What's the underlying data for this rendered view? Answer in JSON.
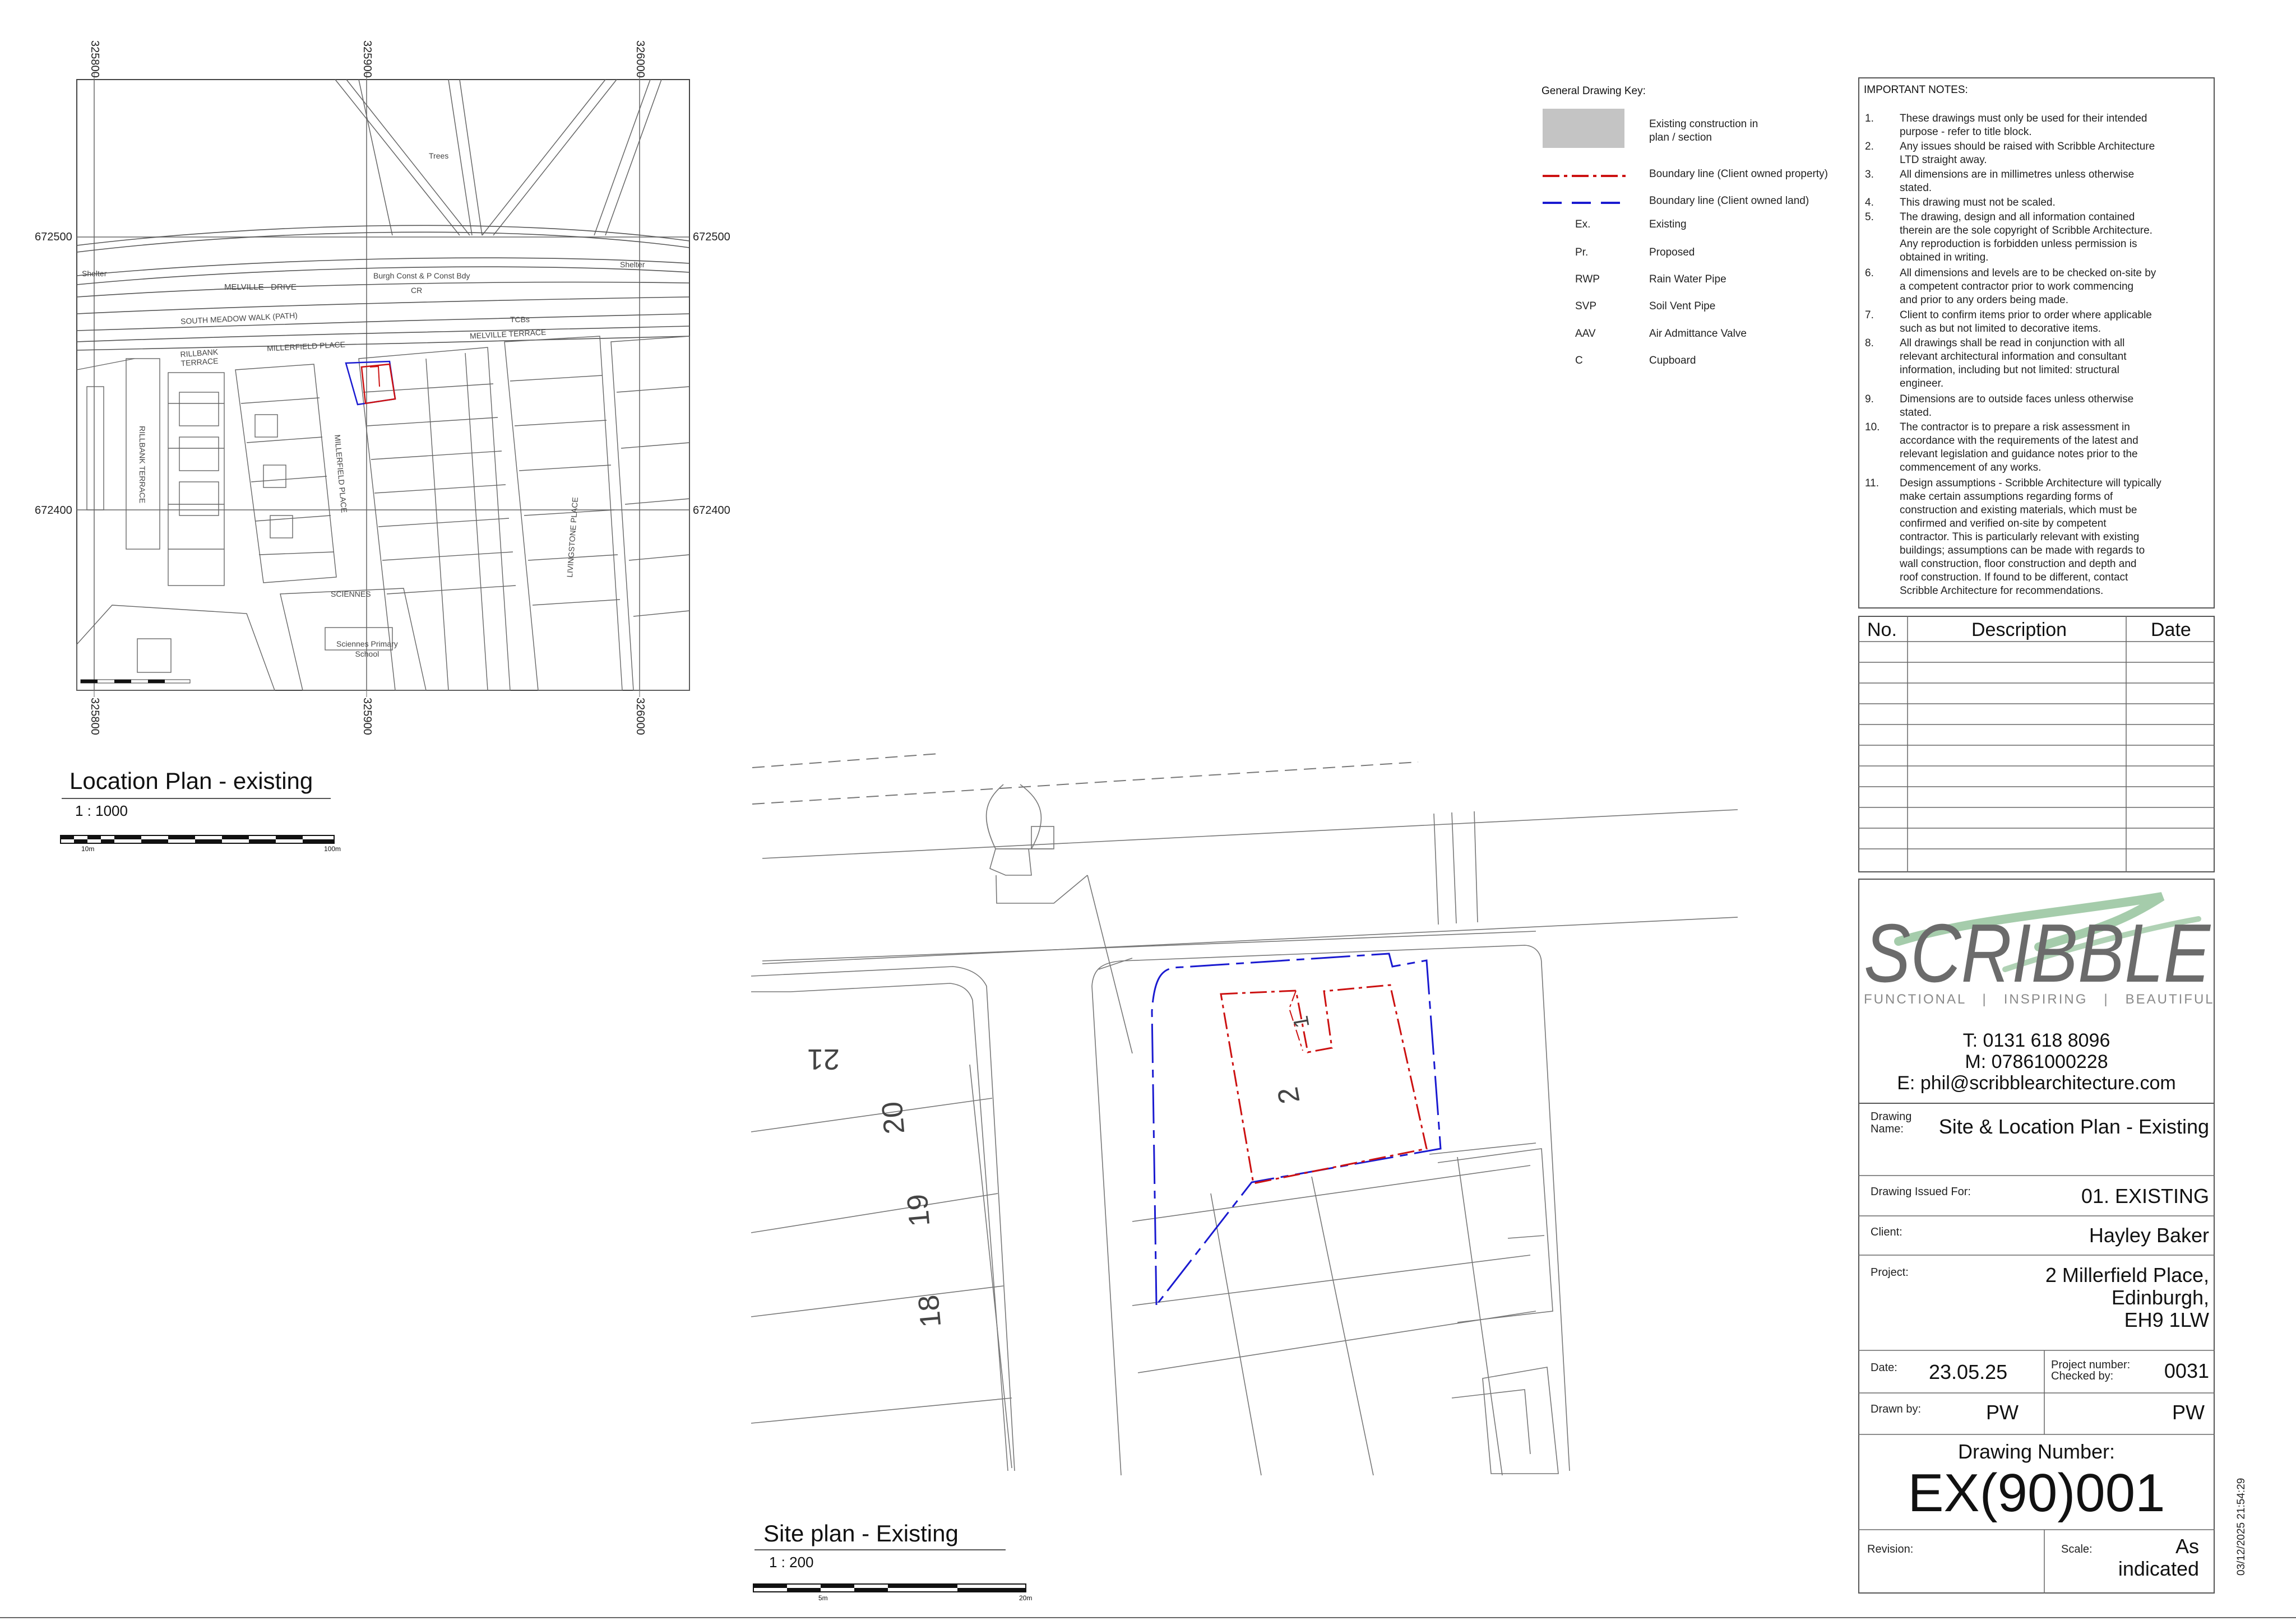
{
  "location_plan": {
    "grid_top": [
      "325800",
      "325900",
      "326000"
    ],
    "grid_bottom": [
      "325800",
      "325900",
      "326000"
    ],
    "grid_left": [
      "672500",
      "672400"
    ],
    "grid_right": [
      "672500",
      "672400"
    ],
    "labels": {
      "trees": "Trees",
      "shelter_left": "Shelter",
      "shelter_right": "Shelter",
      "melville_drive": "MELVILLE   DRIVE",
      "burgh": "Burgh Const & P Const Bdy",
      "cr": "CR",
      "south_meadow": "SOUTH MEADOW WALK (PATH)",
      "tcbs": "TCBs",
      "melville_terrace": "MELVILLE TERRACE",
      "rillbank_terrace": "RILLBANK\nTERRACE",
      "millerfield_place_h": "MILLERFIELD PLACE",
      "millerfield_place_v": "MILLERFIELD PLACE",
      "rillbank_terrace_v": "RILLBANK TERRACE",
      "livingstone_place": "LIVINGSTONE PLACE",
      "sciennes": "SCIENNES",
      "school": "Sciennes Primary\nSchool"
    },
    "title": "Location Plan - existing",
    "scale": "1 : 1000",
    "scalebar_labels": [
      "10m",
      "100m"
    ]
  },
  "site_plan": {
    "numbers": [
      "21",
      "20",
      "19",
      "18",
      "2",
      "1"
    ],
    "title": "Site plan - Existing",
    "scale": "1 : 200",
    "scalebar_labels": [
      "5m",
      "20m"
    ]
  },
  "key": {
    "title": "General Drawing Key:",
    "items": [
      {
        "symbol": "",
        "text": "Existing construction in\nplan / section"
      },
      {
        "symbol": "",
        "text": "Boundary line (Client owned property)"
      },
      {
        "symbol": "",
        "text": "Boundary line (Client owned land)"
      },
      {
        "symbol": "Ex.",
        "text": "Existing"
      },
      {
        "symbol": "Pr.",
        "text": "Proposed"
      },
      {
        "symbol": "RWP",
        "text": "Rain Water Pipe"
      },
      {
        "symbol": "SVP",
        "text": "Soil Vent Pipe"
      },
      {
        "symbol": "AAV",
        "text": "Air Admittance Valve"
      },
      {
        "symbol": "C",
        "text": "Cupboard"
      }
    ],
    "colors": {
      "fill": "#c4c4c4",
      "property_line": "#cc1111",
      "land_line": "#1a1ad0"
    }
  },
  "notes": {
    "title": "IMPORTANT NOTES:",
    "items": [
      {
        "n": "1.",
        "t": "These drawings must only be used for their intended\npurpose - refer to title block."
      },
      {
        "n": "2.",
        "t": "Any issues should be raised with Scribble Architecture\nLTD straight away."
      },
      {
        "n": "3.",
        "t": "All dimensions are in millimetres unless otherwise\nstated."
      },
      {
        "n": "4.",
        "t": "This drawing must not be scaled."
      },
      {
        "n": "5.",
        "t": "The drawing, design and all information contained\ntherein are the sole copyright of Scribble Architecture.\nAny reproduction is forbidden unless permission is\nobtained in writing."
      },
      {
        "n": "6.",
        "t": "All dimensions and levels are to be checked on-site by\na competent contractor prior to work commencing\nand prior to any orders being made."
      },
      {
        "n": "7.",
        "t": "Client to confirm items prior to order where applicable\nsuch as but not limited to decorative items."
      },
      {
        "n": "8.",
        "t": "All drawings shall be read in conjunction with all\nrelevant architectural information and consultant\ninformation, including but not limited: structural\nengineer."
      },
      {
        "n": "9.",
        "t": "Dimensions are to outside faces unless otherwise\nstated."
      },
      {
        "n": "10.",
        "t": "The contractor is to prepare a risk assessment in\naccordance with the requirements of the latest and\nrelevant legislation and guidance notes prior to the\ncommencement of any works."
      },
      {
        "n": "11.",
        "t": "Design assumptions - Scribble Architecture will typically\nmake certain assumptions regarding forms of\nconstruction and existing materials, which must be\nconfirmed and verified on-site by competent\ncontractor. This is particularly relevant with existing\nbuildings; assumptions can be made with regards to\nwall construction, floor construction and depth and\nroof construction. If found to be different, contact\nScribble Architecture for recommendations."
      }
    ]
  },
  "revisions": {
    "headers": [
      "No.",
      "Description",
      "Date"
    ]
  },
  "company": {
    "logo_text": "SCRIBBLE",
    "tagline": "FUNCTIONAL   |   INSPIRING   |   BEAUTIFUL",
    "phone": "T: 0131 618 8096",
    "mobile": "M: 07861000228",
    "email": "E: phil@scribblearchitecture.com",
    "logo_color": "#6b6b6b",
    "accent_color": "#8fbf96"
  },
  "title_block": {
    "drawing_name_label": "Drawing\nName:",
    "drawing_name": "Site & Location Plan - Existing",
    "issued_for_label": "Drawing Issued For:",
    "issued_for": "01. EXISTING",
    "client_label": "Client:",
    "client": "Hayley Baker",
    "project_label": "Project:",
    "project": "2 Millerfield Place,\nEdinburgh,\nEH9 1LW",
    "date_label": "Date:",
    "date": "23.05.25",
    "project_number_label": "Project number:\nChecked by:",
    "project_number": "0031",
    "drawn_by_label": "Drawn by:",
    "drawn_by": "PW",
    "checked_by": "PW",
    "drawing_number_label": "Drawing Number:",
    "drawing_number": "EX(90)001",
    "revision_label": "Revision:",
    "revision": "",
    "scale_label": "Scale:",
    "scale": "As\nindicated"
  },
  "timestamp": "03/12/2025 21:54:29"
}
